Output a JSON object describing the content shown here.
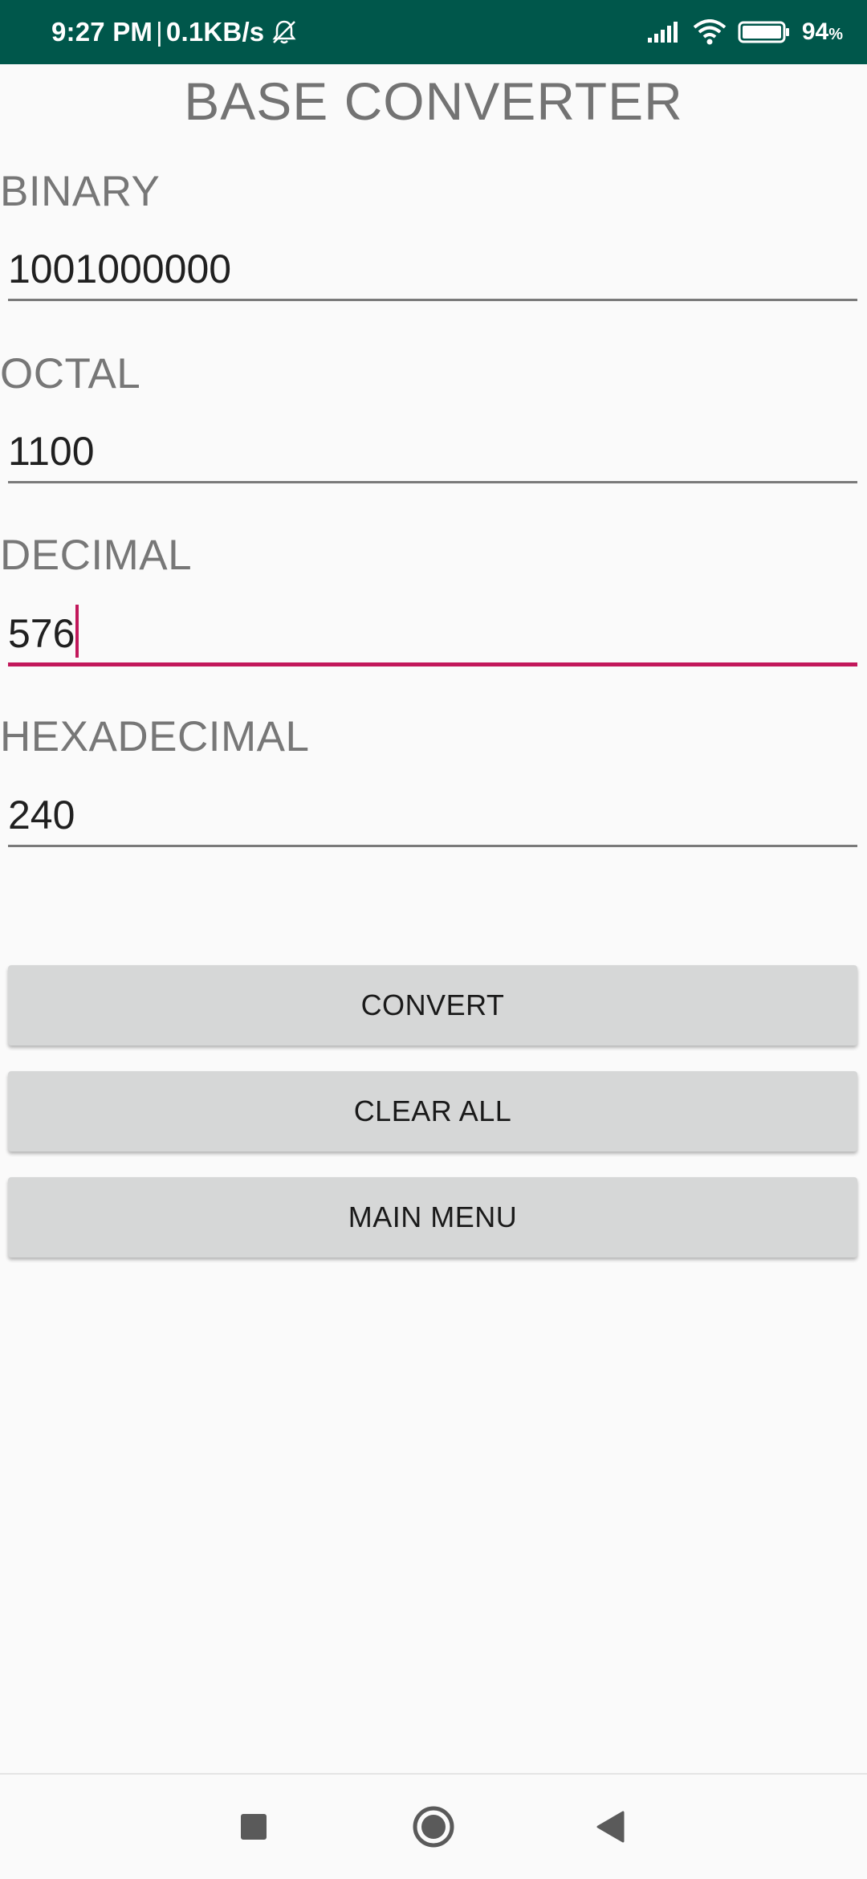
{
  "status_bar": {
    "time": "9:27 PM",
    "separator": "|",
    "network_speed": "0.1KB/s",
    "battery_percent": "94",
    "battery_unit": "%",
    "icons": [
      "bell-off-icon",
      "cellular-signal-icon",
      "wifi-icon",
      "battery-icon"
    ]
  },
  "header": {
    "title": "BASE CONVERTER"
  },
  "fields": {
    "binary": {
      "label": "BINARY",
      "value": "1001000000"
    },
    "octal": {
      "label": "OCTAL",
      "value": "1100"
    },
    "decimal": {
      "label": "DECIMAL",
      "value": "576",
      "focused": true
    },
    "hexadecimal": {
      "label": "HEXADECIMAL",
      "value": "240"
    }
  },
  "buttons": {
    "convert": "CONVERT",
    "clear_all": "CLEAR ALL",
    "main_menu": "MAIN MENU"
  },
  "nav_bar": {
    "icons": [
      "recents-square-icon",
      "home-circle-icon",
      "back-triangle-icon"
    ]
  },
  "colors": {
    "status_bar": "#00574b",
    "accent": "#c2185b",
    "button_bg": "#d6d7d7",
    "background": "#fafafa"
  }
}
